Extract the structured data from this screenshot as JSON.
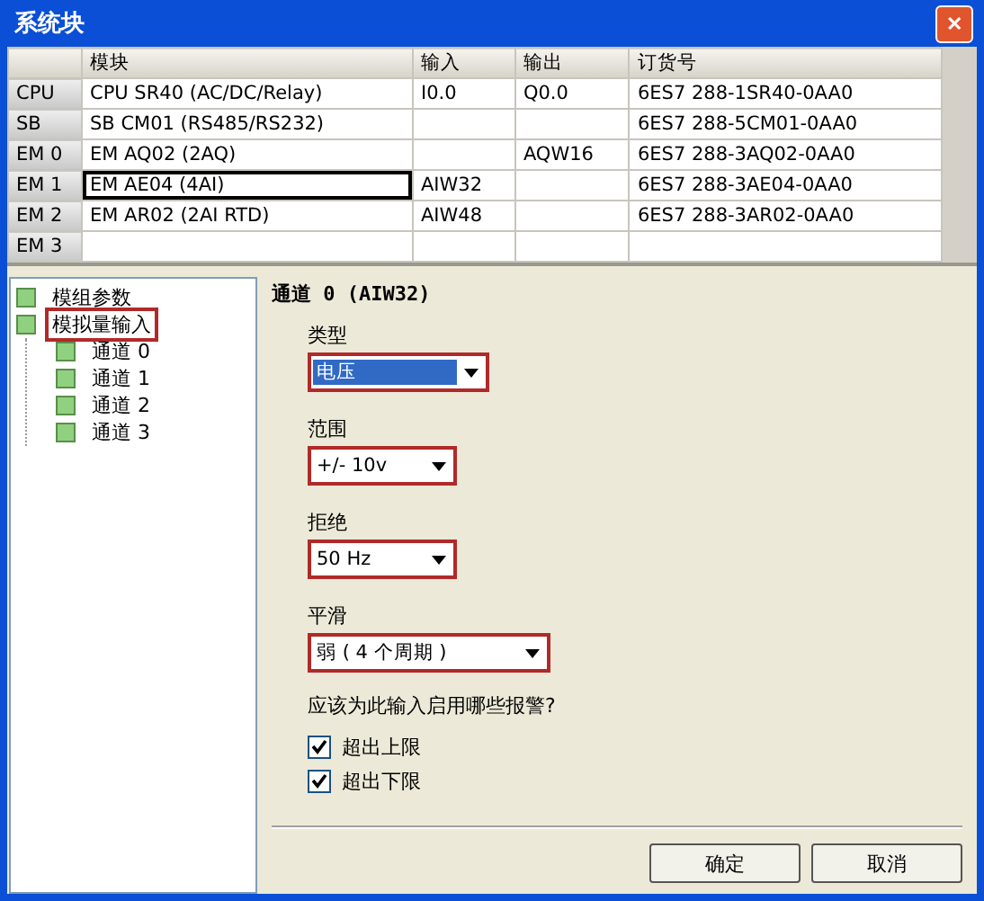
{
  "window": {
    "title": "系统块",
    "close": "✕"
  },
  "table": {
    "columns": [
      "模块",
      "输入",
      "输出",
      "订货号"
    ],
    "rows": [
      {
        "header": "CPU",
        "cells": [
          "CPU SR40 (AC/DC/Relay)",
          "I0.0",
          "Q0.0",
          "6ES7 288-1SR40-0AA0"
        ],
        "selected": false
      },
      {
        "header": "SB",
        "cells": [
          "SB CM01 (RS485/RS232)",
          "",
          "",
          "6ES7 288-5CM01-0AA0"
        ],
        "selected": false
      },
      {
        "header": "EM 0",
        "cells": [
          "EM AQ02 (2AQ)",
          "",
          "AQW16",
          "6ES7 288-3AQ02-0AA0"
        ],
        "selected": false
      },
      {
        "header": "EM 1",
        "cells": [
          "EM AE04 (4AI)",
          "AIW32",
          "",
          "6ES7 288-3AE04-0AA0"
        ],
        "selected": true
      },
      {
        "header": "EM 2",
        "cells": [
          "EM AR02 (2AI RTD)",
          "AIW48",
          "",
          "6ES7 288-3AR02-0AA0"
        ],
        "selected": false
      },
      {
        "header": "EM 3",
        "cells": [
          "",
          "",
          "",
          ""
        ],
        "selected": false
      }
    ]
  },
  "tree": [
    {
      "label": "模组参数",
      "highlighted": false
    },
    {
      "label": "模拟量输入",
      "highlighted": true,
      "children": [
        {
          "label": "通道 0",
          "highlighted": false
        },
        {
          "label": "通道 1",
          "highlighted": false
        },
        {
          "label": "通道 2",
          "highlighted": false
        },
        {
          "label": "通道 3",
          "highlighted": false
        }
      ]
    }
  ],
  "panel": {
    "title": "通道 0 (AIW32)",
    "fields": [
      {
        "label": "类型",
        "value": "电压",
        "focused": true,
        "highlighted": true
      },
      {
        "label": "范围",
        "value": "+/- 10v",
        "focused": false,
        "highlighted": true
      },
      {
        "label": "拒绝",
        "value": "50 Hz",
        "focused": false,
        "highlighted": true
      },
      {
        "label": "平滑",
        "value": "弱 ( 4 个周期 )",
        "focused": false,
        "highlighted": true
      }
    ],
    "question": "应该为此输入启用哪些报警?",
    "checkboxes": [
      {
        "label": "超出上限",
        "checked": true
      },
      {
        "label": "超出下限",
        "checked": true
      }
    ]
  },
  "buttons": [
    "确定",
    "取消"
  ]
}
